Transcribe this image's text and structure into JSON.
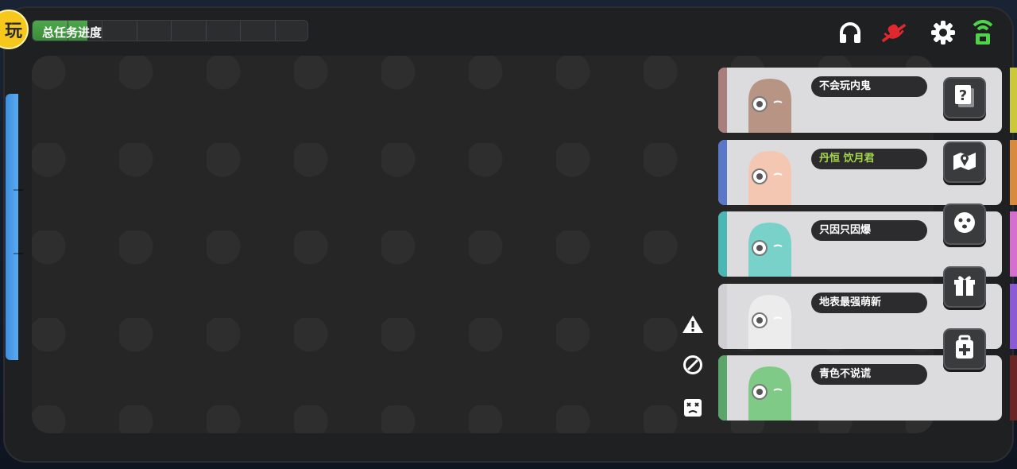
{
  "hud": {
    "badge_char": "玩",
    "task_progress_label": "总任务进度",
    "task_progress_fraction": 0.2,
    "progress_segments": 8
  },
  "top_icons": [
    "headset-icon",
    "muted-microphone-icon",
    "gear-icon",
    "signal-icon"
  ],
  "players": [
    {
      "name": "不会玩内鬼",
      "stripe_color": "#a97f7b",
      "body_color": "#b89484",
      "name_color": "#ffffff"
    },
    {
      "name": "丹恒 饮月君",
      "stripe_color": "#5a78c8",
      "body_color": "#f4c7b3",
      "name_color": "#a6d64b"
    },
    {
      "name": "只因只因爆",
      "stripe_color": "#49b7b4",
      "body_color": "#78d2c9",
      "name_color": "#ffffff"
    },
    {
      "name": "地表最强萌新",
      "stripe_color": "#d0d0d4",
      "body_color": "#ececec",
      "name_color": "#ffffff"
    },
    {
      "name": "青色不说谎",
      "stripe_color": "#5aa66a",
      "body_color": "#7fca86",
      "name_color": "#ffffff"
    }
  ],
  "side_buttons": [
    "question-card-icon",
    "map-icon",
    "emote-face-icon",
    "gift-icon",
    "medical-kit-icon"
  ],
  "action_icons": [
    "warning-icon",
    "block-icon",
    "dead-face-icon"
  ],
  "right_strip_colors": [
    "#c9c93a",
    "#d98a3a",
    "#d46fd0",
    "#8a5bd4",
    "#6b2424"
  ]
}
